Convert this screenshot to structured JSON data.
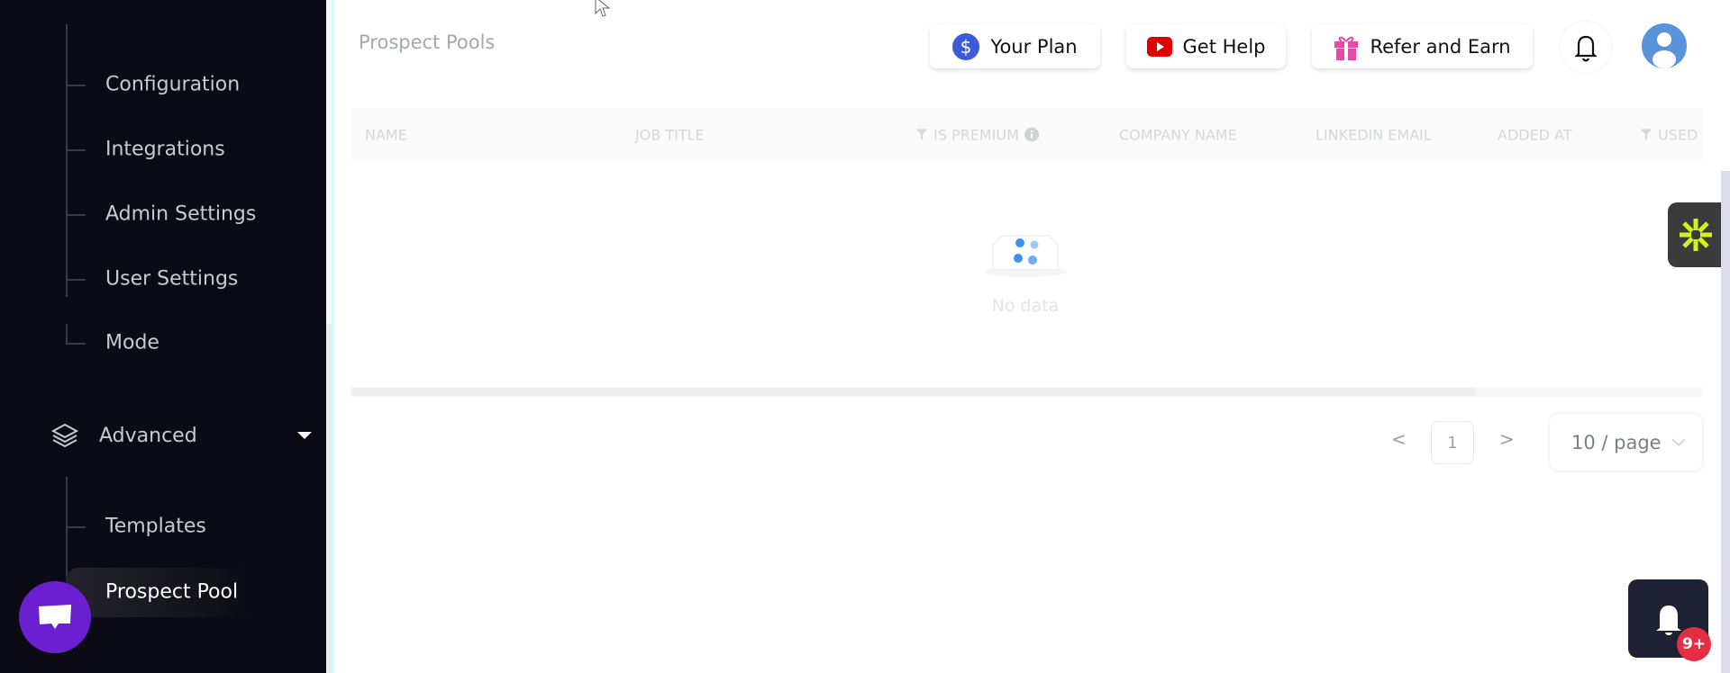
{
  "sidebar": {
    "settings_items": [
      "Configuration",
      "Integrations",
      "Admin Settings",
      "User Settings",
      "Mode"
    ],
    "advanced_label": "Advanced",
    "advanced_items": [
      "Templates",
      "Prospect Pool"
    ],
    "active_item": "Prospect Pool"
  },
  "header": {
    "title": "Prospect Pools",
    "your_plan": "Your Plan",
    "get_help": "Get Help",
    "refer": "Refer and Earn"
  },
  "table": {
    "columns": [
      "NAME",
      "JOB TITLE",
      "IS PREMIUM",
      "COMPANY NAME",
      "LINKEDIN EMAIL",
      "ADDED AT",
      "USED"
    ],
    "empty_text": "No data"
  },
  "pagination": {
    "prev": "<",
    "current": "1",
    "next": ">",
    "page_size": "10 / page"
  },
  "notifications": {
    "badge": "9+"
  },
  "colors": {
    "sidebar_bg": "#0a0b14",
    "chat": "#6a1fd0",
    "avatar": "#5b92dc",
    "badge": "#e52d43",
    "widget_star": "#d6f01c"
  }
}
